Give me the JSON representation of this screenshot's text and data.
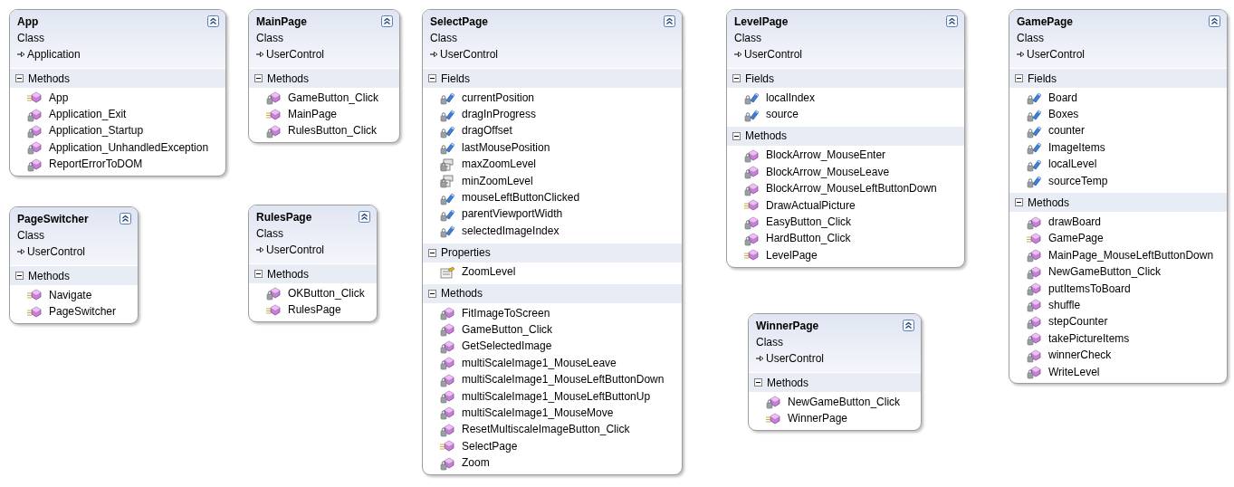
{
  "classes": [
    {
      "name": "App",
      "stereotype": "Class",
      "base": "Application",
      "sections": [
        {
          "title": "Methods",
          "expanded": true,
          "members": [
            {
              "name": "App",
              "kind": "method",
              "private": false
            },
            {
              "name": "Application_Exit",
              "kind": "method",
              "private": true
            },
            {
              "name": "Application_Startup",
              "kind": "method",
              "private": true
            },
            {
              "name": "Application_UnhandledException",
              "kind": "method",
              "private": true
            },
            {
              "name": "ReportErrorToDOM",
              "kind": "method",
              "private": true
            }
          ]
        }
      ]
    },
    {
      "name": "MainPage",
      "stereotype": "Class",
      "base": "UserControl",
      "sections": [
        {
          "title": "Methods",
          "expanded": true,
          "members": [
            {
              "name": "GameButton_Click",
              "kind": "method",
              "private": true
            },
            {
              "name": "MainPage",
              "kind": "method",
              "private": false
            },
            {
              "name": "RulesButton_Click",
              "kind": "method",
              "private": true
            }
          ]
        }
      ]
    },
    {
      "name": "SelectPage",
      "stereotype": "Class",
      "base": "UserControl",
      "sections": [
        {
          "title": "Fields",
          "expanded": true,
          "members": [
            {
              "name": "currentPosition",
              "kind": "field",
              "private": true
            },
            {
              "name": "dragInProgress",
              "kind": "field",
              "private": true
            },
            {
              "name": "dragOffset",
              "kind": "field",
              "private": true
            },
            {
              "name": "lastMousePosition",
              "kind": "field",
              "private": true
            },
            {
              "name": "maxZoomLevel",
              "kind": "constant",
              "private": true
            },
            {
              "name": "minZoomLevel",
              "kind": "constant",
              "private": true
            },
            {
              "name": "mouseLeftButtonClicked",
              "kind": "field",
              "private": true
            },
            {
              "name": "parentViewportWidth",
              "kind": "field",
              "private": true
            },
            {
              "name": "selectedImageIndex",
              "kind": "field",
              "private": true
            }
          ]
        },
        {
          "title": "Properties",
          "expanded": true,
          "members": [
            {
              "name": "ZoomLevel",
              "kind": "property",
              "private": false
            }
          ]
        },
        {
          "title": "Methods",
          "expanded": true,
          "members": [
            {
              "name": "FitImageToScreen",
              "kind": "method",
              "private": true
            },
            {
              "name": "GameButton_Click",
              "kind": "method",
              "private": true
            },
            {
              "name": "GetSelectedImage",
              "kind": "method",
              "private": true
            },
            {
              "name": "multiScaleImage1_MouseLeave",
              "kind": "method",
              "private": true
            },
            {
              "name": "multiScaleImage1_MouseLeftButtonDown",
              "kind": "method",
              "private": true
            },
            {
              "name": "multiScaleImage1_MouseLeftButtonUp",
              "kind": "method",
              "private": true
            },
            {
              "name": "multiScaleImage1_MouseMove",
              "kind": "method",
              "private": true
            },
            {
              "name": "ResetMultiscaleImageButton_Click",
              "kind": "method",
              "private": true
            },
            {
              "name": "SelectPage",
              "kind": "method",
              "private": false
            },
            {
              "name": "Zoom",
              "kind": "method",
              "private": true
            }
          ]
        }
      ]
    },
    {
      "name": "LevelPage",
      "stereotype": "Class",
      "base": "UserControl",
      "sections": [
        {
          "title": "Fields",
          "expanded": true,
          "members": [
            {
              "name": "localIndex",
              "kind": "field",
              "private": true
            },
            {
              "name": "source",
              "kind": "field",
              "private": true
            }
          ]
        },
        {
          "title": "Methods",
          "expanded": true,
          "members": [
            {
              "name": "BlockArrow_MouseEnter",
              "kind": "method",
              "private": true
            },
            {
              "name": "BlockArrow_MouseLeave",
              "kind": "method",
              "private": true
            },
            {
              "name": "BlockArrow_MouseLeftButtonDown",
              "kind": "method",
              "private": true
            },
            {
              "name": "DrawActualPicture",
              "kind": "method",
              "private": false
            },
            {
              "name": "EasyButton_Click",
              "kind": "method",
              "private": true
            },
            {
              "name": "HardButton_Click",
              "kind": "method",
              "private": true
            },
            {
              "name": "LevelPage",
              "kind": "method",
              "private": false
            }
          ]
        }
      ]
    },
    {
      "name": "GamePage",
      "stereotype": "Class",
      "base": "UserControl",
      "sections": [
        {
          "title": "Fields",
          "expanded": true,
          "members": [
            {
              "name": "Board",
              "kind": "field",
              "private": true
            },
            {
              "name": "Boxes",
              "kind": "field",
              "private": true
            },
            {
              "name": "counter",
              "kind": "field",
              "private": true
            },
            {
              "name": "ImageItems",
              "kind": "field",
              "private": true
            },
            {
              "name": "localLevel",
              "kind": "field",
              "private": true
            },
            {
              "name": "sourceTemp",
              "kind": "field",
              "private": true
            }
          ]
        },
        {
          "title": "Methods",
          "expanded": true,
          "members": [
            {
              "name": "drawBoard",
              "kind": "method",
              "private": true
            },
            {
              "name": "GamePage",
              "kind": "method",
              "private": false
            },
            {
              "name": "MainPage_MouseLeftButtonDown",
              "kind": "method",
              "private": true
            },
            {
              "name": "NewGameButton_Click",
              "kind": "method",
              "private": true
            },
            {
              "name": "putItemsToBoard",
              "kind": "method",
              "private": true
            },
            {
              "name": "shuffle",
              "kind": "method",
              "private": true
            },
            {
              "name": "stepCounter",
              "kind": "method",
              "private": true
            },
            {
              "name": "takePictureItems",
              "kind": "method",
              "private": true
            },
            {
              "name": "winnerCheck",
              "kind": "method",
              "private": true
            },
            {
              "name": "WriteLevel",
              "kind": "method",
              "private": true
            }
          ]
        }
      ]
    },
    {
      "name": "PageSwitcher",
      "stereotype": "Class",
      "base": "UserControl",
      "sections": [
        {
          "title": "Methods",
          "expanded": true,
          "members": [
            {
              "name": "Navigate",
              "kind": "method",
              "private": false
            },
            {
              "name": "PageSwitcher",
              "kind": "method",
              "private": false
            }
          ]
        }
      ]
    },
    {
      "name": "RulesPage",
      "stereotype": "Class",
      "base": "UserControl",
      "sections": [
        {
          "title": "Methods",
          "expanded": true,
          "members": [
            {
              "name": "OKButton_Click",
              "kind": "method",
              "private": true
            },
            {
              "name": "RulesPage",
              "kind": "method",
              "private": false
            }
          ]
        }
      ]
    },
    {
      "name": "WinnerPage",
      "stereotype": "Class",
      "base": "UserControl",
      "sections": [
        {
          "title": "Methods",
          "expanded": true,
          "members": [
            {
              "name": "NewGameButton_Click",
              "kind": "method",
              "private": true
            },
            {
              "name": "WinnerPage",
              "kind": "method",
              "private": false
            }
          ]
        }
      ]
    }
  ]
}
